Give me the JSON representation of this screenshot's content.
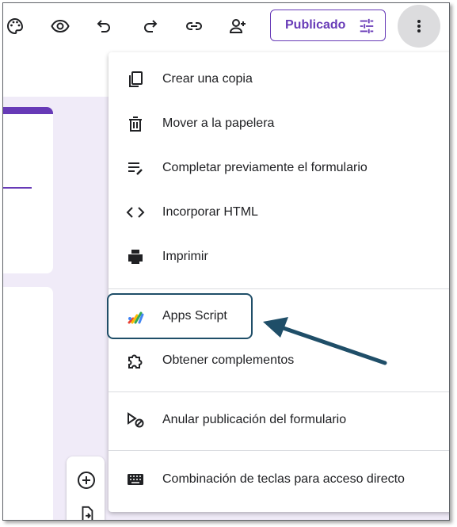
{
  "toolbar": {
    "icons": [
      "palette-icon",
      "preview-eye-icon",
      "undo-icon",
      "redo-icon",
      "link-icon",
      "add-collaborator-icon"
    ],
    "publish_label": "Publicado",
    "more_icon": "more-vert-icon"
  },
  "menu": {
    "items": [
      {
        "label": "Crear una copia",
        "icon": "copy-icon"
      },
      {
        "label": "Mover a la papelera",
        "icon": "trash-icon"
      },
      {
        "label": "Completar previamente el formulario",
        "icon": "prefill-icon"
      },
      {
        "label": "Incorporar HTML",
        "icon": "code-icon"
      },
      {
        "label": "Imprimir",
        "icon": "printer-icon"
      },
      {
        "label": "Apps Script",
        "icon": "apps-script-icon"
      },
      {
        "label": "Obtener complementos",
        "icon": "addons-puzzle-icon"
      },
      {
        "label": "Anular publicación del formulario",
        "icon": "unpublish-icon"
      },
      {
        "label": "Combinación de teclas para acceso directo",
        "icon": "keyboard-icon"
      }
    ]
  },
  "colors": {
    "accent": "#673ab7",
    "canvas": "#f0ebf8",
    "annotation": "#1f4e68",
    "more_button_bg": "#dcdcde"
  }
}
